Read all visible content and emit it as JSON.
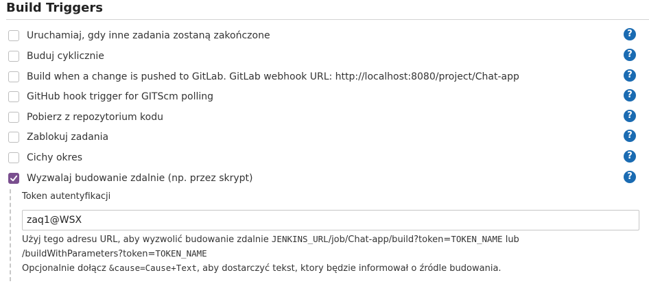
{
  "section": {
    "title": "Build Triggers"
  },
  "triggers": [
    {
      "label": "Uruchamiaj, gdy inne zadania zostaną zakończone",
      "checked": false
    },
    {
      "label": "Buduj cyklicznie",
      "checked": false
    },
    {
      "label": "Build when a change is pushed to GitLab. GitLab webhook URL: http://localhost:8080/project/Chat-app",
      "checked": false
    },
    {
      "label": "GitHub hook trigger for GITScm polling",
      "checked": false
    },
    {
      "label": "Pobierz z repozytorium kodu",
      "checked": false
    },
    {
      "label": "Zablokuj zadania",
      "checked": false
    },
    {
      "label": "Cichy okres",
      "checked": false
    },
    {
      "label": "Wyzwalaj budowanie zdalnie (np. przez skrypt)",
      "checked": true
    }
  ],
  "help_icon_glyph": "?",
  "remote_trigger": {
    "token_label": "Token autentyfikacji",
    "token_value": "zaq1@WSX",
    "help_line1_prefix": "Użyj tego adresu URL, aby wyzwolić budowanie zdalnie ",
    "help_line1_code": "JENKINS_URL",
    "help_line1_path": "/job/Chat-app/build?token=",
    "help_line1_token": "TOKEN_NAME",
    "help_line1_suffix": " lub",
    "help_line2_path": "/buildWithParameters?token=",
    "help_line2_token": "TOKEN_NAME",
    "help_line3_prefix": "Opcjonalnie dołącz ",
    "help_line3_code": "&cause=Cause+Text",
    "help_line3_suffix": ", aby dostarczyć tekst, ktory będzie informował o źródle budowania."
  },
  "colors": {
    "checkbox_checked": "#7a4f8f",
    "help_icon": "#1a6bb2"
  },
  "icons": {
    "help": "help-icon",
    "check": "checkmark-icon"
  }
}
